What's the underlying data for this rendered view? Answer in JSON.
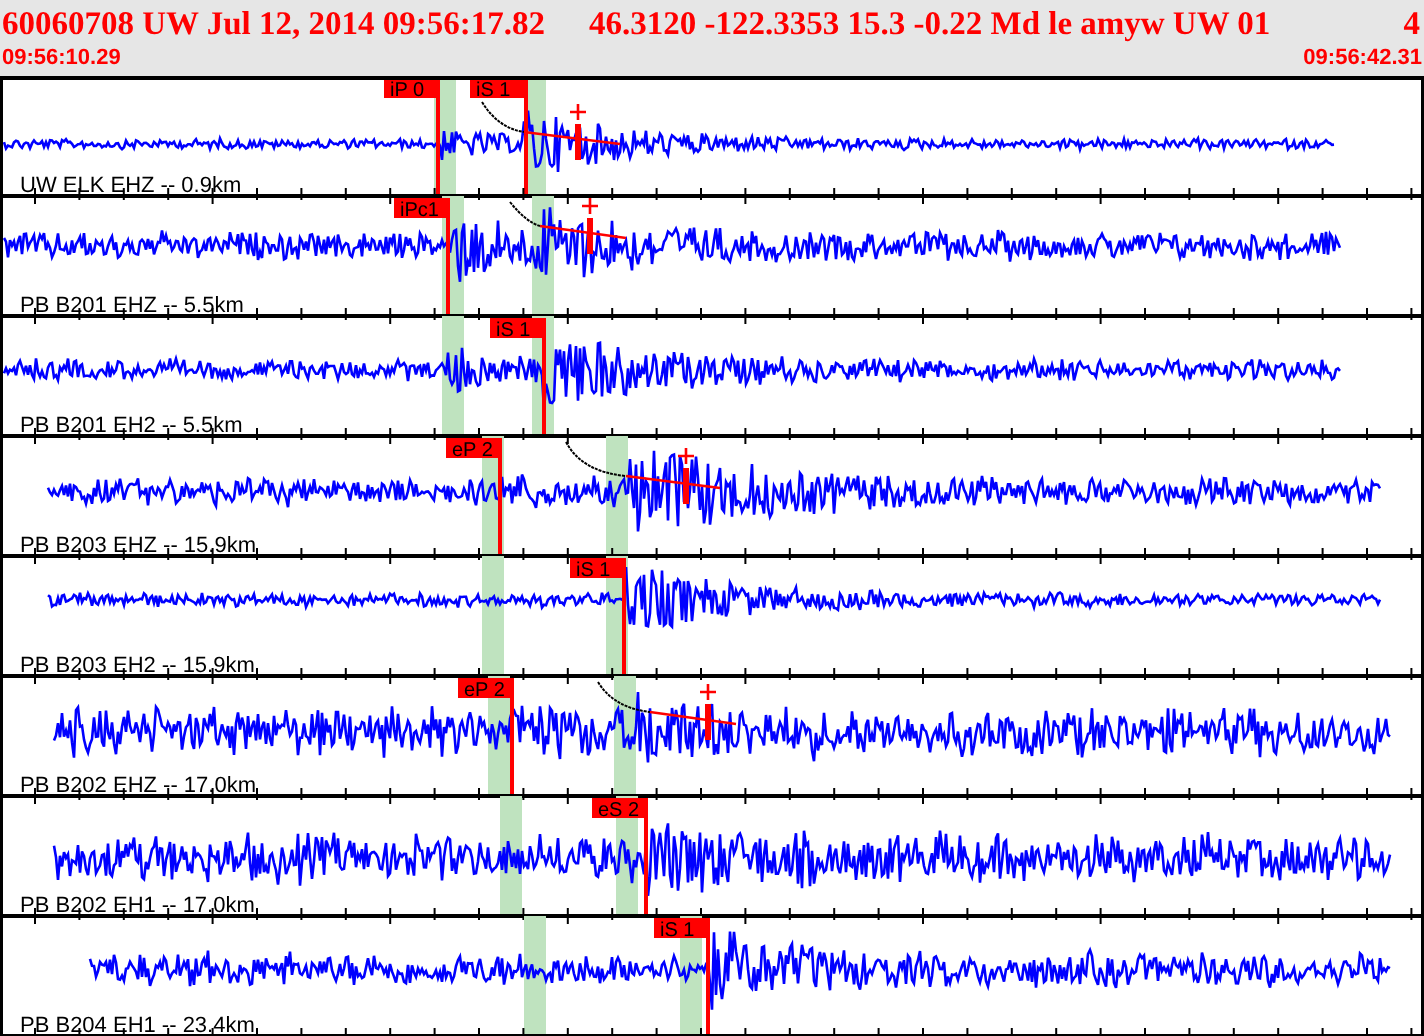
{
  "header": {
    "event_id_and_time": "60060708 UW Jul 12, 2014 09:56:17.82",
    "location_and_magnitude": "46.3120 -122.3353 15.3 -0.22 Md le amyw UW 01",
    "column_3": "4",
    "start_time": "09:56:10.29",
    "end_time": "09:56:42.31"
  },
  "traces": [
    {
      "label": "UW ELK EHZ -- 0.9km",
      "picks": [
        {
          "label": "iP 0"
        },
        {
          "label": "iS 1"
        }
      ]
    },
    {
      "label": "PB B201 EHZ -- 5.5km",
      "picks": [
        {
          "label": "iPc1"
        }
      ]
    },
    {
      "label": "PB B201 EH2 -- 5.5km",
      "picks": [
        {
          "label": "iS 1"
        }
      ]
    },
    {
      "label": "PB B203 EHZ -- 15.9km",
      "picks": [
        {
          "label": "eP 2"
        }
      ]
    },
    {
      "label": "PB B203 EH2 -- 15.9km",
      "picks": [
        {
          "label": "iS 1"
        }
      ]
    },
    {
      "label": "PB B202 EHZ -- 17.0km",
      "picks": [
        {
          "label": "eP 2"
        }
      ]
    },
    {
      "label": "PB B202 EH1 -- 17.0km",
      "picks": [
        {
          "label": "eS 2"
        }
      ]
    },
    {
      "label": "PB B204 EH1 -- 23.4km",
      "picks": [
        {
          "label": "iS 1"
        }
      ]
    }
  ]
}
